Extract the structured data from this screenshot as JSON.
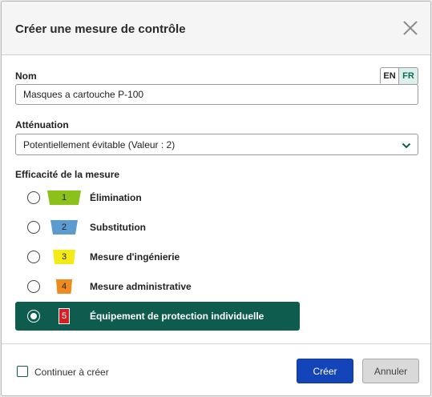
{
  "dialog": {
    "title": "Créer une mesure de contrôle",
    "close_icon": "close-icon"
  },
  "name_field": {
    "label": "Nom",
    "value": "Masques a cartouche P-100",
    "languages": [
      "EN",
      "FR"
    ],
    "active_language": "EN"
  },
  "attenuation": {
    "label": "Atténuation",
    "selected": "Potentiellement évitable (Valeur : 2)",
    "chevron_icon": "chevron-down-icon"
  },
  "effectiveness": {
    "label": "Efficacité de la mesure",
    "options": [
      {
        "level": "1",
        "label": "Élimination",
        "color": "#8cc11c",
        "selected": false
      },
      {
        "level": "2",
        "label": "Substitution",
        "color": "#5b9bd0",
        "selected": false
      },
      {
        "level": "3",
        "label": "Mesure d'ingénierie",
        "color": "#f4ea18",
        "selected": false
      },
      {
        "level": "4",
        "label": "Mesure administrative",
        "color": "#f08a1c",
        "selected": false
      },
      {
        "level": "5",
        "label": "Équipement de protection individuelle",
        "color": "#d11f26",
        "selected": true
      }
    ]
  },
  "footer": {
    "continue_label": "Continuer à créer",
    "create_label": "Créer",
    "cancel_label": "Annuler"
  },
  "colors": {
    "selected_row": "#0e5c4d",
    "primary_button": "#1345b8",
    "header_bg": "#f5f5f5"
  }
}
